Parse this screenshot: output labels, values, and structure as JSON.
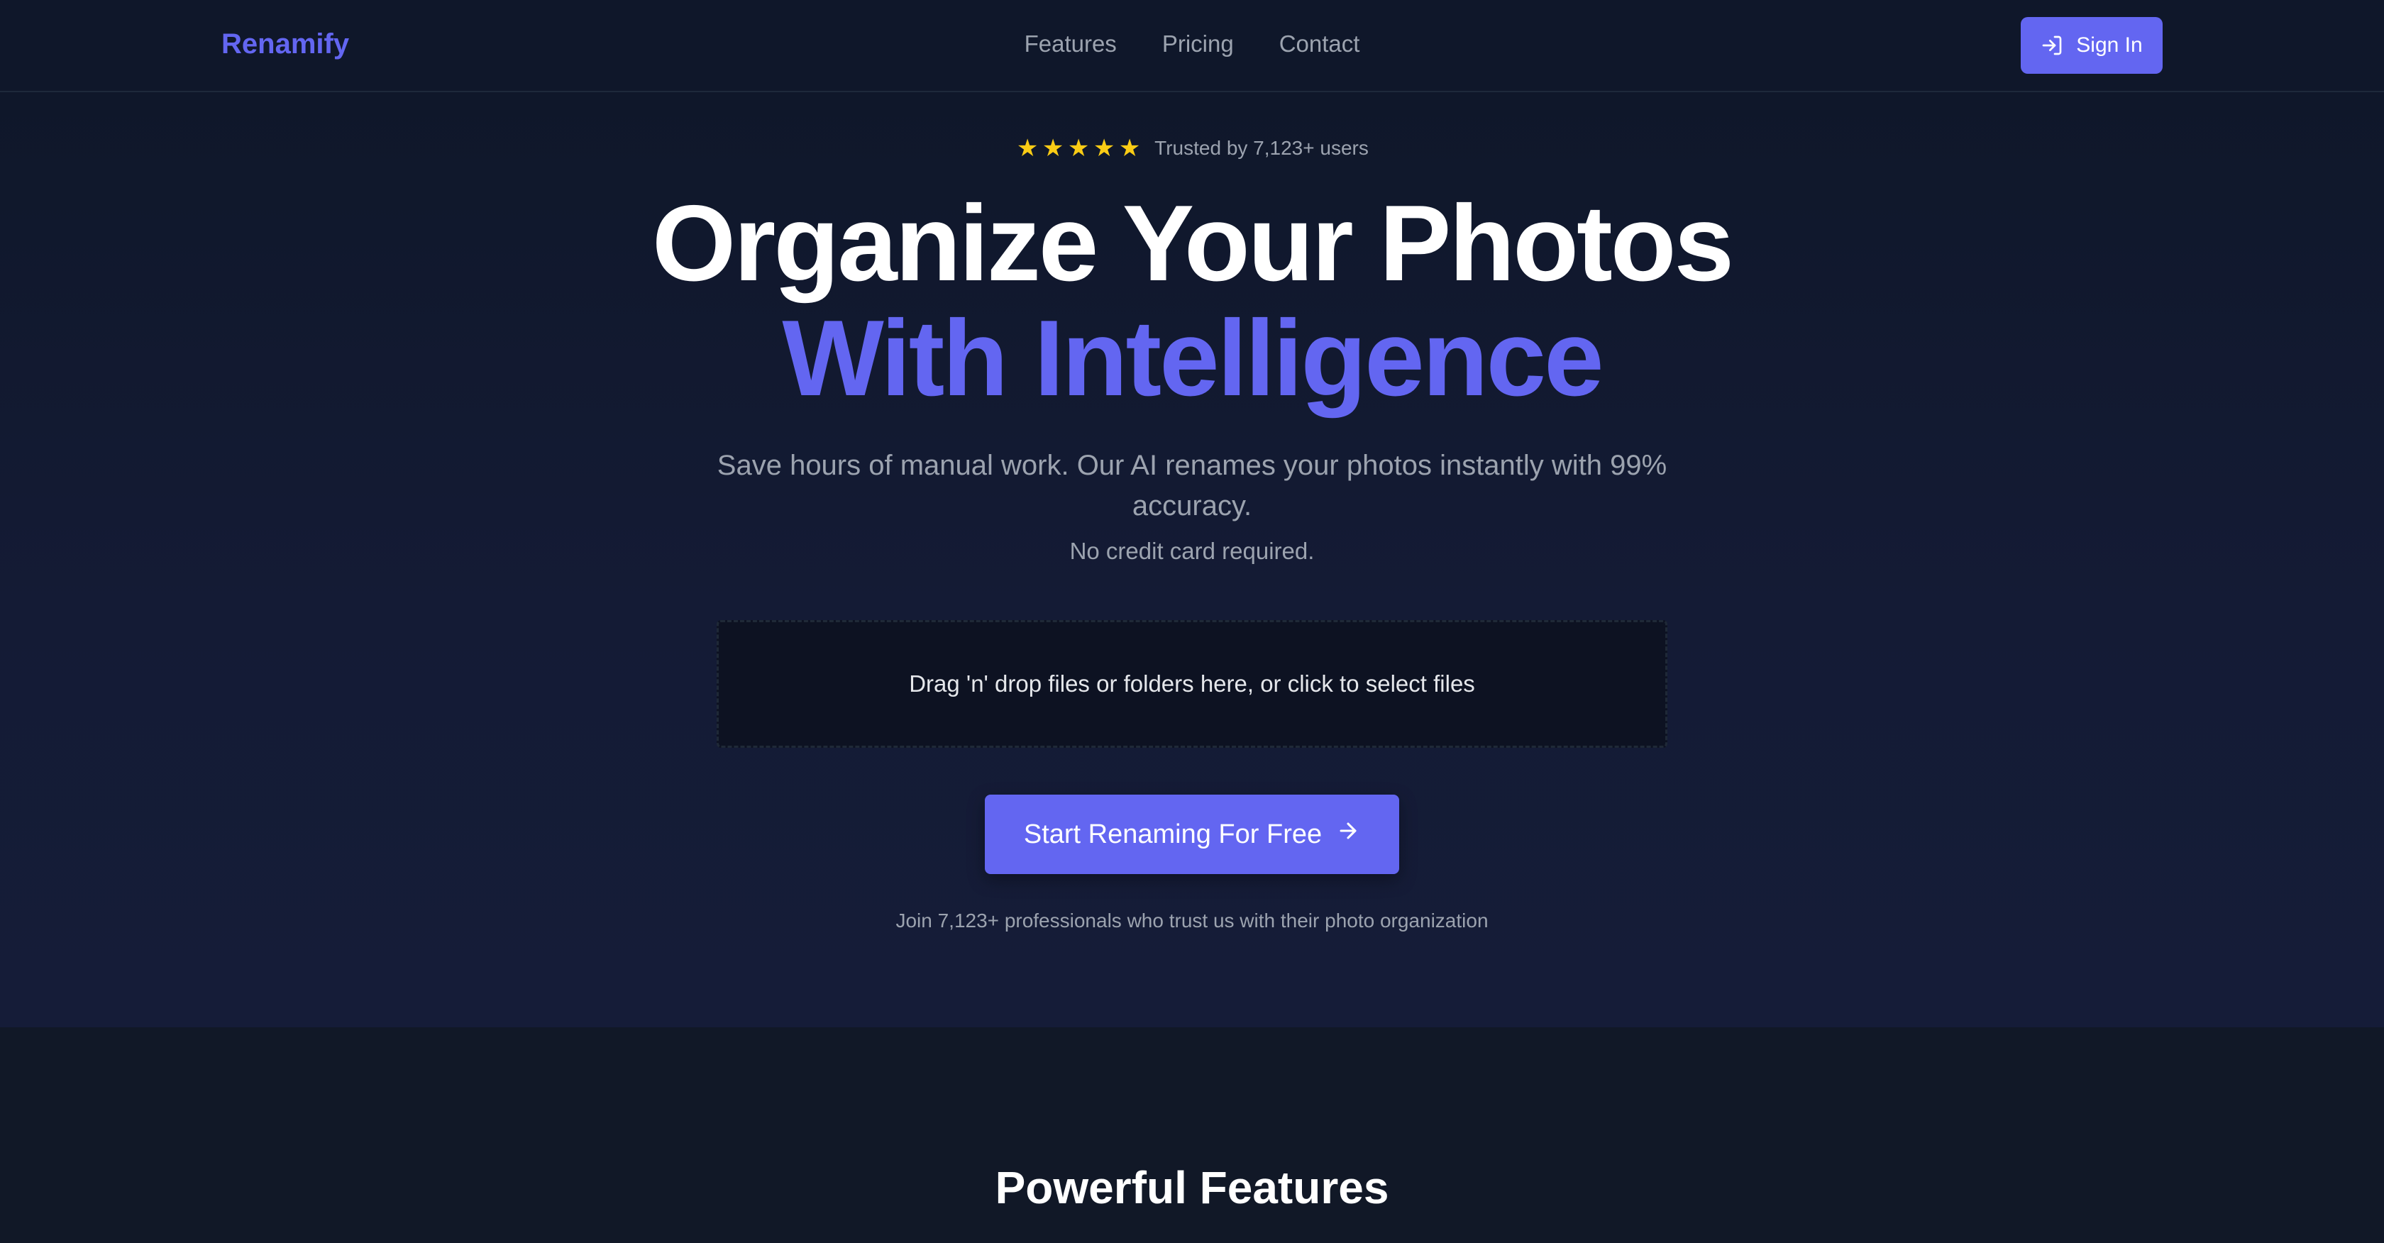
{
  "nav": {
    "logo": "Renamify",
    "links": [
      "Features",
      "Pricing",
      "Contact"
    ],
    "signin_label": "Sign In"
  },
  "hero": {
    "rating_stars": 5,
    "rating_text": "Trusted by 7,123+ users",
    "headline_line1": "Organize Your Photos",
    "headline_line2": "With Intelligence",
    "subtext": "Save hours of manual work. Our AI renames your photos instantly with 99% accuracy.",
    "no_credit_card": "No credit card required.",
    "dropzone_text": "Drag 'n' drop files or folders here, or click to select files",
    "cta_label": "Start Renaming For Free",
    "social_proof": "Join 7,123+ professionals who trust us with their photo organization"
  },
  "features": {
    "title": "Powerful Features"
  },
  "colors": {
    "accent": "#6366f1",
    "background": "#111827",
    "star": "#facc15",
    "muted_text": "#9ca3af"
  }
}
